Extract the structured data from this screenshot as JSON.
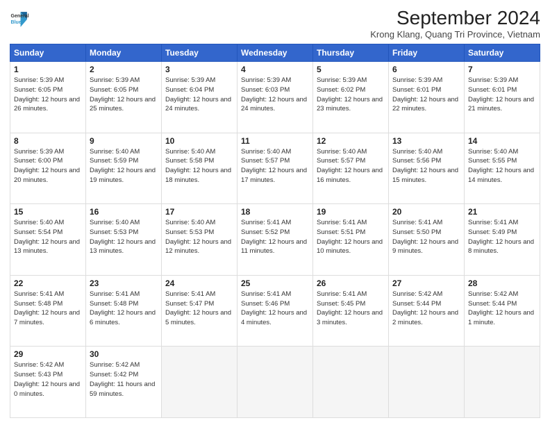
{
  "header": {
    "logo_line1": "General",
    "logo_line2": "Blue",
    "month_title": "September 2024",
    "location": "Krong Klang, Quang Tri Province, Vietnam"
  },
  "weekdays": [
    "Sunday",
    "Monday",
    "Tuesday",
    "Wednesday",
    "Thursday",
    "Friday",
    "Saturday"
  ],
  "weeks": [
    [
      {
        "day": "1",
        "sunrise": "5:39 AM",
        "sunset": "6:05 PM",
        "daylight": "12 hours and 26 minutes."
      },
      {
        "day": "2",
        "sunrise": "5:39 AM",
        "sunset": "6:05 PM",
        "daylight": "12 hours and 25 minutes."
      },
      {
        "day": "3",
        "sunrise": "5:39 AM",
        "sunset": "6:04 PM",
        "daylight": "12 hours and 24 minutes."
      },
      {
        "day": "4",
        "sunrise": "5:39 AM",
        "sunset": "6:03 PM",
        "daylight": "12 hours and 24 minutes."
      },
      {
        "day": "5",
        "sunrise": "5:39 AM",
        "sunset": "6:02 PM",
        "daylight": "12 hours and 23 minutes."
      },
      {
        "day": "6",
        "sunrise": "5:39 AM",
        "sunset": "6:01 PM",
        "daylight": "12 hours and 22 minutes."
      },
      {
        "day": "7",
        "sunrise": "5:39 AM",
        "sunset": "6:01 PM",
        "daylight": "12 hours and 21 minutes."
      }
    ],
    [
      {
        "day": "8",
        "sunrise": "5:39 AM",
        "sunset": "6:00 PM",
        "daylight": "12 hours and 20 minutes."
      },
      {
        "day": "9",
        "sunrise": "5:40 AM",
        "sunset": "5:59 PM",
        "daylight": "12 hours and 19 minutes."
      },
      {
        "day": "10",
        "sunrise": "5:40 AM",
        "sunset": "5:58 PM",
        "daylight": "12 hours and 18 minutes."
      },
      {
        "day": "11",
        "sunrise": "5:40 AM",
        "sunset": "5:57 PM",
        "daylight": "12 hours and 17 minutes."
      },
      {
        "day": "12",
        "sunrise": "5:40 AM",
        "sunset": "5:57 PM",
        "daylight": "12 hours and 16 minutes."
      },
      {
        "day": "13",
        "sunrise": "5:40 AM",
        "sunset": "5:56 PM",
        "daylight": "12 hours and 15 minutes."
      },
      {
        "day": "14",
        "sunrise": "5:40 AM",
        "sunset": "5:55 PM",
        "daylight": "12 hours and 14 minutes."
      }
    ],
    [
      {
        "day": "15",
        "sunrise": "5:40 AM",
        "sunset": "5:54 PM",
        "daylight": "12 hours and 13 minutes."
      },
      {
        "day": "16",
        "sunrise": "5:40 AM",
        "sunset": "5:53 PM",
        "daylight": "12 hours and 13 minutes."
      },
      {
        "day": "17",
        "sunrise": "5:40 AM",
        "sunset": "5:53 PM",
        "daylight": "12 hours and 12 minutes."
      },
      {
        "day": "18",
        "sunrise": "5:41 AM",
        "sunset": "5:52 PM",
        "daylight": "12 hours and 11 minutes."
      },
      {
        "day": "19",
        "sunrise": "5:41 AM",
        "sunset": "5:51 PM",
        "daylight": "12 hours and 10 minutes."
      },
      {
        "day": "20",
        "sunrise": "5:41 AM",
        "sunset": "5:50 PM",
        "daylight": "12 hours and 9 minutes."
      },
      {
        "day": "21",
        "sunrise": "5:41 AM",
        "sunset": "5:49 PM",
        "daylight": "12 hours and 8 minutes."
      }
    ],
    [
      {
        "day": "22",
        "sunrise": "5:41 AM",
        "sunset": "5:48 PM",
        "daylight": "12 hours and 7 minutes."
      },
      {
        "day": "23",
        "sunrise": "5:41 AM",
        "sunset": "5:48 PM",
        "daylight": "12 hours and 6 minutes."
      },
      {
        "day": "24",
        "sunrise": "5:41 AM",
        "sunset": "5:47 PM",
        "daylight": "12 hours and 5 minutes."
      },
      {
        "day": "25",
        "sunrise": "5:41 AM",
        "sunset": "5:46 PM",
        "daylight": "12 hours and 4 minutes."
      },
      {
        "day": "26",
        "sunrise": "5:41 AM",
        "sunset": "5:45 PM",
        "daylight": "12 hours and 3 minutes."
      },
      {
        "day": "27",
        "sunrise": "5:42 AM",
        "sunset": "5:44 PM",
        "daylight": "12 hours and 2 minutes."
      },
      {
        "day": "28",
        "sunrise": "5:42 AM",
        "sunset": "5:44 PM",
        "daylight": "12 hours and 1 minute."
      }
    ],
    [
      {
        "day": "29",
        "sunrise": "5:42 AM",
        "sunset": "5:43 PM",
        "daylight": "12 hours and 0 minutes."
      },
      {
        "day": "30",
        "sunrise": "5:42 AM",
        "sunset": "5:42 PM",
        "daylight": "11 hours and 59 minutes."
      },
      null,
      null,
      null,
      null,
      null
    ]
  ]
}
